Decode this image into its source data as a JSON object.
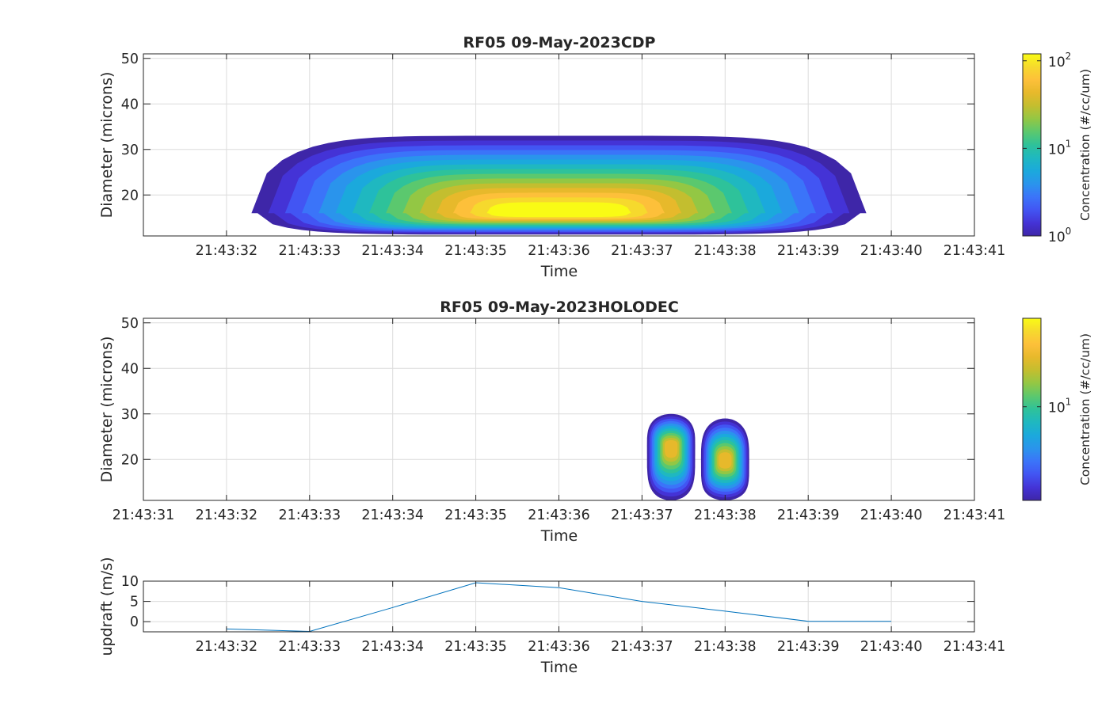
{
  "colormap": [
    "#3e26a8",
    "#4433d6",
    "#4255f3",
    "#3b74f9",
    "#2a94ec",
    "#1ba9dc",
    "#1fb8c0",
    "#2ec29a",
    "#5bc86e",
    "#93c744",
    "#c3be2f",
    "#e7b92b",
    "#fdc03a",
    "#f6d92d",
    "#f9fb15"
  ],
  "chart_data": [
    {
      "type": "heatmap",
      "title": "RF05 09-May-2023CDP",
      "xlabel": "Time",
      "ylabel": "Diameter (microns)",
      "x_ticklabels": [
        "21:43:32",
        "21:43:33",
        "21:43:34",
        "21:43:35",
        "21:43:36",
        "21:43:37",
        "21:43:38",
        "21:43:39",
        "21:43:40",
        "21:43:41"
      ],
      "xlim": [
        "21:43:31",
        "21:43:41"
      ],
      "ylim": [
        11,
        51
      ],
      "y_ticks": [
        20,
        30,
        40,
        50
      ],
      "y_ticklabels": [
        "20",
        "30",
        "40",
        "50"
      ],
      "grid": true,
      "colorbar": {
        "label": "Concentration (#/cc/um)",
        "scale": "log",
        "range": [
          1,
          120
        ],
        "ticks": [
          {
            "base": "10",
            "exp": "0"
          },
          {
            "base": "10",
            "exp": "1"
          },
          {
            "base": "10",
            "exp": "2"
          }
        ]
      },
      "blobs": [
        {
          "name": "main droplet mode",
          "t_start": "21:43:32.3",
          "t_end": "21:43:39.7",
          "diameter_peak": 16,
          "peak_concentration": 100,
          "max_diameter": 33
        }
      ]
    },
    {
      "type": "heatmap",
      "title": "RF05 09-May-2023HOLODEC",
      "xlabel": "Time",
      "ylabel": "Diameter (microns)",
      "x_ticklabels": [
        "21:43:31",
        "21:43:32",
        "21:43:33",
        "21:43:34",
        "21:43:35",
        "21:43:36",
        "21:43:37",
        "21:43:38",
        "21:43:39",
        "21:43:40",
        "21:43:41"
      ],
      "xlim": [
        "21:43:31",
        "21:43:41"
      ],
      "ylim": [
        11,
        51
      ],
      "y_ticks": [
        20,
        30,
        40,
        50
      ],
      "y_ticklabels": [
        "20",
        "30",
        "40",
        "50"
      ],
      "grid": true,
      "colorbar": {
        "label": "Concentration (#/cc/um)",
        "scale": "log",
        "range": [
          1.5,
          60
        ],
        "ticks": [
          {
            "base": "10",
            "exp": "1"
          }
        ]
      },
      "blobs": [
        {
          "name": "cell A",
          "t_center": "21:43:37.35",
          "diameter_peak": 23,
          "peak_concentration": 40,
          "max_diameter": 30
        },
        {
          "name": "cell B",
          "t_center": "21:43:38.0",
          "diameter_peak": 20,
          "peak_concentration": 45,
          "max_diameter": 29
        }
      ]
    },
    {
      "type": "line",
      "xlabel": "Time",
      "ylabel": "updraft (m/s)",
      "x_ticklabels": [
        "21:43:32",
        "21:43:33",
        "21:43:34",
        "21:43:35",
        "21:43:36",
        "21:43:37",
        "21:43:38",
        "21:43:39",
        "21:43:40",
        "21:43:41"
      ],
      "xlim": [
        "21:43:31",
        "21:43:41"
      ],
      "ylim": [
        -2.5,
        10
      ],
      "y_ticks": [
        0,
        5,
        10
      ],
      "y_ticklabels": [
        "0",
        "5",
        "10"
      ],
      "grid": true,
      "color": "#0072bd",
      "series": [
        {
          "x": [
            "21:43:32",
            "21:43:33",
            "21:43:34",
            "21:43:35",
            "21:43:36",
            "21:43:37",
            "21:43:38",
            "21:43:39",
            "21:43:40"
          ],
          "y": [
            -1.8,
            -2.4,
            3.5,
            9.6,
            8.4,
            5.0,
            2.6,
            0.1,
            0.1
          ]
        }
      ]
    }
  ]
}
